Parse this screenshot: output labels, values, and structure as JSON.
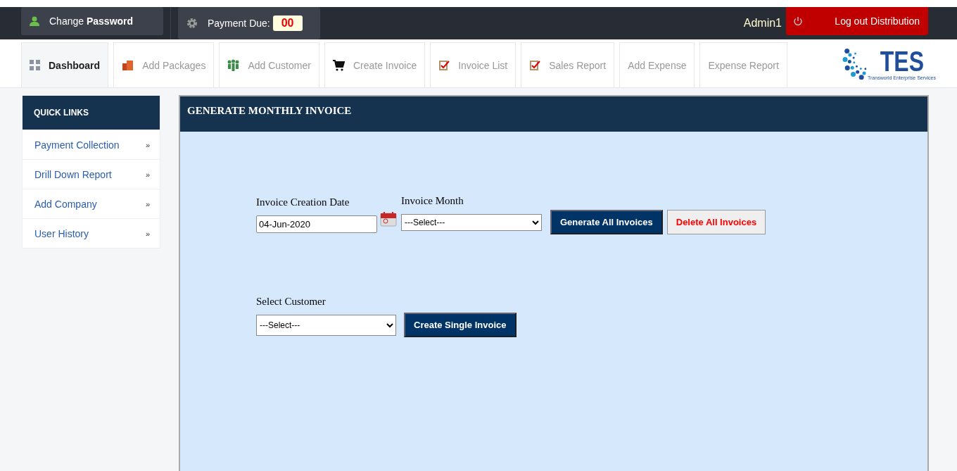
{
  "top_bar": {
    "change_password": {
      "prefix": "Change ",
      "bold": "Password"
    },
    "payment_due": {
      "label": "Payment Due:",
      "count": "00"
    },
    "user": "Admin1",
    "logout": "Log out Distribution"
  },
  "tabs": [
    {
      "label": "Dashboard",
      "selected": true,
      "kind": "grid"
    },
    {
      "label": "Add Packages",
      "selected": false,
      "kind": "boxes"
    },
    {
      "label": "Add Customer",
      "selected": false,
      "kind": "people"
    },
    {
      "label": "Create Invoice",
      "selected": false,
      "kind": "cart"
    },
    {
      "label": "Invoice List",
      "selected": false,
      "kind": "clipboard"
    },
    {
      "label": "Sales Report",
      "selected": false,
      "kind": "clipboard"
    },
    {
      "label": "Add Expense",
      "selected": false,
      "kind": "none"
    },
    {
      "label": "Expense Report",
      "selected": false,
      "kind": "none"
    }
  ],
  "logo": {
    "name": "TES",
    "tagline": "Transworld Enterprise Services"
  },
  "sidebar": {
    "title": "QUICK LINKS",
    "items": [
      {
        "label": "Payment Collection",
        "arrow": "»"
      },
      {
        "label": "Drill Down Report",
        "arrow": "»"
      },
      {
        "label": "Add Company",
        "arrow": "»"
      },
      {
        "label": "User History",
        "arrow": "»"
      }
    ]
  },
  "panel": {
    "title": "GENERATE MONTHLY INVOICE",
    "date": {
      "label": "Invoice Creation Date",
      "value": "04-Jun-2020"
    },
    "month": {
      "label": "Invoice Month",
      "value": "---Select---"
    },
    "generate_button": "Generate All Invoices",
    "delete_button": "Delete All Invoices",
    "customer": {
      "label": "Select Customer",
      "value": "---Select---"
    },
    "single_button": "Create Single Invoice"
  }
}
